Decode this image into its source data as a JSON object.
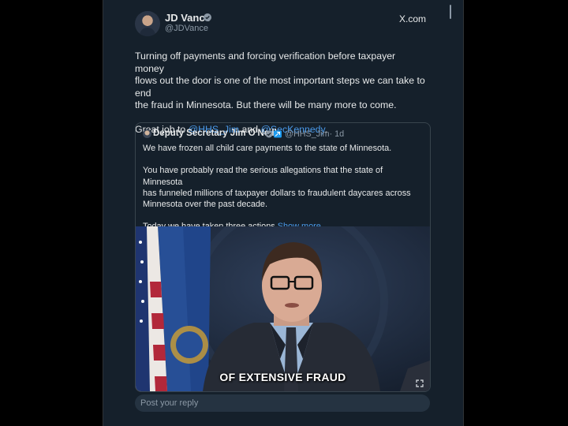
{
  "tweet": {
    "author_name": "JD Vance",
    "author_handle": "@JDVance",
    "site_label": "X.com",
    "text_line1": "Turning off payments and forcing verification before taxpayer money",
    "text_line2": "flows out the door is one of the most important steps we can take to end",
    "text_line3": "the fraud in Minnesota. But there will be many more to come.",
    "thanks_prefix": "Great job to ",
    "mention1": "@HHS_Jim",
    "thanks_and": " and ",
    "mention2": "@SecKennedy",
    "thanks_suffix": "."
  },
  "quoted": {
    "author_name": "Deputy Secretary Jim O'Neill",
    "author_handle": "@HHS_Jim",
    "time": "· 1d",
    "p1": "We have frozen all child care payments to the state of Minnesota.",
    "p2_line1": "You have probably read the serious allegations that the state of Minnesota",
    "p2_line2": "has funneled millions of taxpayer dollars to fraudulent daycares across",
    "p2_line3": "Minnesota over the past decade.",
    "p3": "Today we have taken three actions ",
    "show_more": "Show more",
    "video_caption": "OF EXTENSIVE FRAUD"
  },
  "reply": {
    "placeholder": "Post your reply"
  },
  "colors": {
    "background": "#15202b",
    "link": "#4a99e9",
    "verified": "#1d9bf0",
    "text": "#e7e9ea",
    "secondary": "#8b98a5"
  }
}
